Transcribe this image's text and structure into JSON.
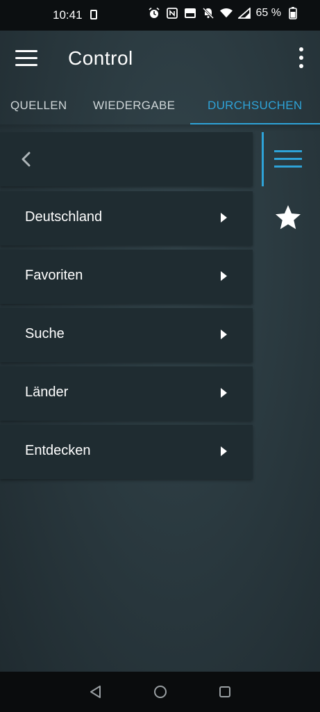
{
  "status_bar": {
    "time": "10:41",
    "battery_percent": "65 %",
    "icons": [
      "sim-card-icon",
      "alarm-icon",
      "nfc-icon",
      "volte-icon",
      "mute-icon",
      "wifi-icon",
      "signal-icon",
      "battery-icon"
    ]
  },
  "app_bar": {
    "title": "Control"
  },
  "tabs": [
    {
      "label": "QUELLEN"
    },
    {
      "label": "WIEDERGABE"
    },
    {
      "label": "DURCHSUCHEN"
    }
  ],
  "browse": {
    "items": [
      {
        "label": "Deutschland"
      },
      {
        "label": "Favoriten"
      },
      {
        "label": "Suche"
      },
      {
        "label": "Länder"
      },
      {
        "label": "Entdecken"
      }
    ]
  },
  "colors": {
    "accent": "#2ea3d8",
    "panel": "#1f2c31",
    "status_bar": "#0c0f11"
  }
}
